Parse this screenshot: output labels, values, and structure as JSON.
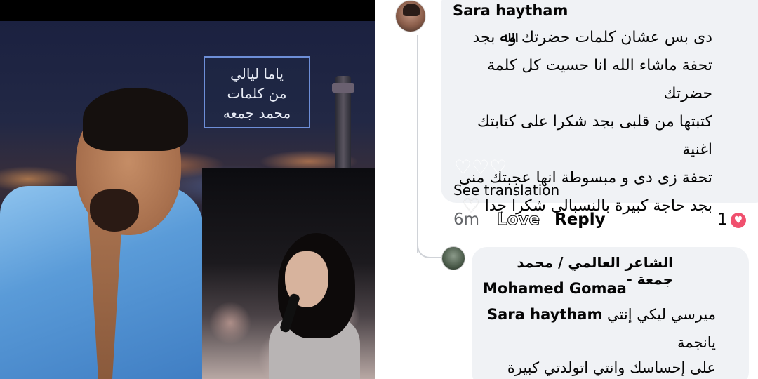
{
  "image_overlay": {
    "title_lines": [
      "ياما ليالي",
      "من كلمات",
      "محمد جمعه"
    ]
  },
  "comment": {
    "author": "Sara haytham",
    "text_lines": [
      "دى بس عشان كلمات حضرتك وﷲ بجد",
      "تحفة ماشاء الله انا حسيت كل كلمة حضرتك",
      "كتبتها من قلبى بجد شكرا على كتابتك اغنية",
      "تحفة زى دى و مبسوطة انها عجبتك منى",
      "بجد حاجة كبيرة بالنسبالى شكرا جدا"
    ],
    "hearts": "♡♡♡",
    "trailing_heart": "♡",
    "see_translation": "See translation",
    "time": "6m",
    "love_label": "Love",
    "reply_label": "Reply",
    "reaction_count": "1",
    "reaction_icon": "heart-reaction-icon"
  },
  "reply": {
    "author_ar": "الشاعر العالمي / محمد جمعة -",
    "author_en": "Mohamed Gomaa",
    "mention": "Sara haytham",
    "line1_rest": "ميرسي ليكي إنتي",
    "line2": "يانجمة",
    "line3": "على إحساسك وانتي اتولدتي كبيرة"
  }
}
